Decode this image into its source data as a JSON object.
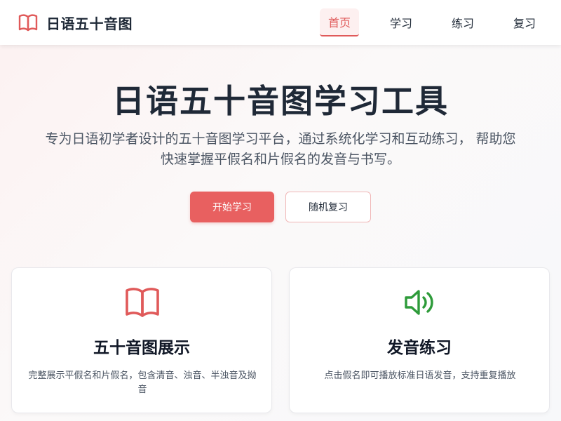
{
  "header": {
    "brand_name": "日语五十音图",
    "nav": [
      {
        "label": "首页",
        "active": true
      },
      {
        "label": "学习",
        "active": false
      },
      {
        "label": "练习",
        "active": false
      },
      {
        "label": "复习",
        "active": false
      }
    ]
  },
  "hero": {
    "title": "日语五十音图学习工具",
    "description": "专为日语初学者设计的五十音图学习平台，通过系统化学习和互动练习， 帮助您快速掌握平假名和片假名的发音与书写。",
    "primary_button": "开始学习",
    "secondary_button": "随机复习"
  },
  "features": [
    {
      "icon": "book-icon",
      "title": "五十音图展示",
      "description": "完整展示平假名和片假名，包含清音、浊音、半浊音及拗音"
    },
    {
      "icon": "speaker-icon",
      "title": "发音练习",
      "description": "点击假名即可播放标准日语发音，支持重复播放"
    }
  ],
  "colors": {
    "accent": "#e05a5a",
    "speaker": "#2e9b3a",
    "text": "#1f2937"
  }
}
